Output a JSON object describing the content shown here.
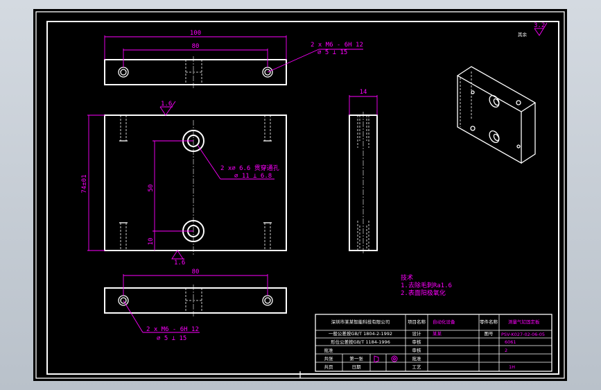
{
  "drawing": {
    "top_view": {
      "overall_width": "100",
      "hole_spacing": "80",
      "thread_note_line1": "2 x  M6 - 6H 12",
      "thread_note_line2": "⌀ 5 ⟂ 15"
    },
    "front_view": {
      "height_dim": "74±01",
      "hole_pitch": "50",
      "bottom_offset": "10",
      "roughness_top": "1.6",
      "roughness_bottom": "1.6",
      "hole_note_line1": "2 x⌀  6.6 贯穿通孔",
      "hole_note_line2": "⌀ 11 ⟂ 6.8"
    },
    "side_view": {
      "thickness": "14"
    },
    "bottom_view": {
      "hole_spacing": "80",
      "thread_note_line1": "2 x  M6 - 6H 12",
      "thread_note_line2": "⌀ 5 ⟂ 15"
    },
    "surface_symbol": {
      "label": "其余",
      "value": "3.2"
    },
    "tech_notes": {
      "title": "技术",
      "line1": "1.去除毛刺Ra1.6",
      "line2": "2.表面阳极氧化"
    }
  },
  "title_block": {
    "company": "深圳市某某智能科技有限公司",
    "standard_row1": "一般公差按GB/T 1804-2-1992",
    "standard_row2": "形位公差按GB/T 1184-1996",
    "cells": {
      "project_label": "项目名称",
      "project_value": "自动化设备",
      "drawing_name_label": "零件名称",
      "drawing_name_value": "测量气缸固定板",
      "design_label": "设计",
      "design_value": "某某",
      "part_no_label": "图号",
      "part_no_value": "PSV-K027-02-06-05",
      "check_label": "审核",
      "material_value": "6061",
      "approve_label": "批准",
      "qty_value": "2",
      "process_label": "工艺",
      "qty2_value": "1H",
      "scale_label": "共张",
      "sheet_label": "第一张",
      "date_label": "日期",
      "proj_label": "共页"
    }
  }
}
